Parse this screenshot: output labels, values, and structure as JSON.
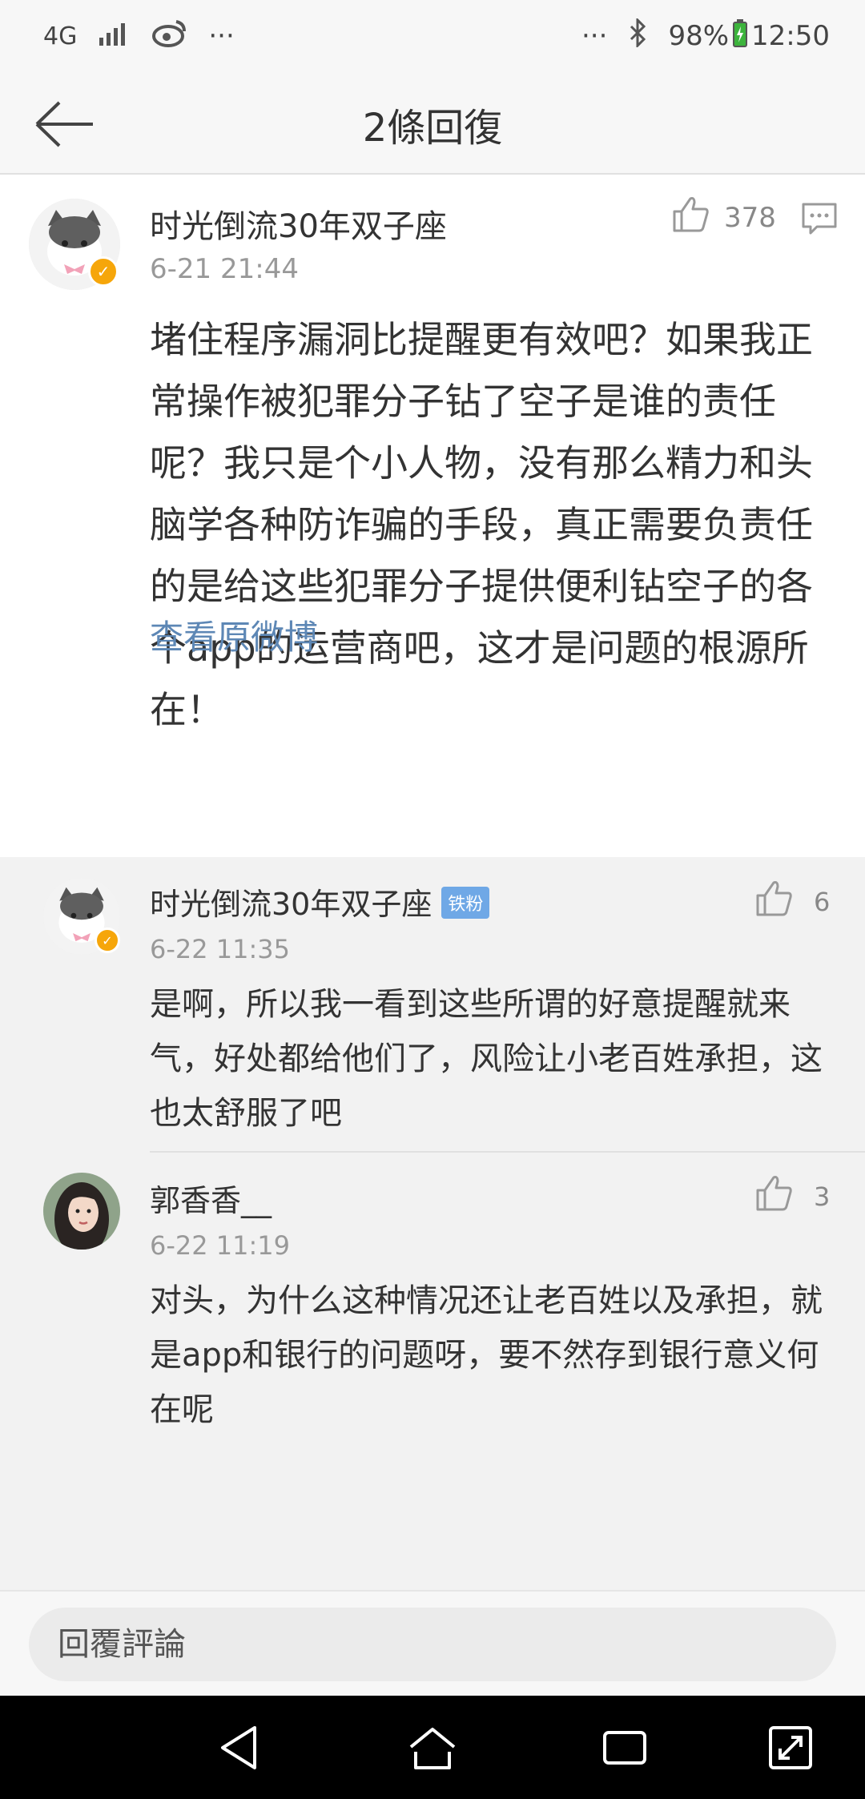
{
  "status_bar": {
    "network": "4G",
    "battery": "98%",
    "time": "12:50",
    "more": "···",
    "more_right": "···"
  },
  "nav": {
    "title": "2條回復"
  },
  "main_comment": {
    "username": "时光倒流30年双子座",
    "time": "6-21 21:44",
    "likes": "378",
    "text": "堵住程序漏洞比提醒更有效吧？如果我正常操作被犯罪分子钻了空子是谁的责任呢？我只是个小人物，没有那么精力和头脑学各种防诈骗的手段，真正需要负责任的是给这些犯罪分子提供便利钻空子的各个app的运营商吧，这才是问题的根源所在！",
    "view_original": "查看原微博"
  },
  "replies": [
    {
      "username": "时光倒流30年双子座",
      "badge": "铁粉",
      "time": "6-22 11:35",
      "likes": "6",
      "text": "是啊，所以我一看到这些所谓的好意提醒就来气，好处都给他们了，风险让小老百姓承担，这也太舒服了吧"
    },
    {
      "username": "郭香香__",
      "time": "6-22 11:19",
      "likes": "3",
      "text": "对头，为什么这种情况还让老百姓以及承担，就是app和银行的问题呀，要不然存到银行意义何在呢"
    }
  ],
  "bottom": {
    "reply_placeholder": "回覆評論"
  },
  "colors": {
    "link": "#5d87b5",
    "verified_badge": "#f6a60a",
    "fan_badge": "#6fa8e6"
  },
  "icons": [
    "back-arrow-icon",
    "like-icon",
    "comment-icon",
    "bluetooth-icon",
    "signal-icon",
    "weibo-icon",
    "battery-icon",
    "nav-back-icon",
    "nav-home-icon",
    "nav-recents-icon",
    "nav-expand-icon"
  ]
}
